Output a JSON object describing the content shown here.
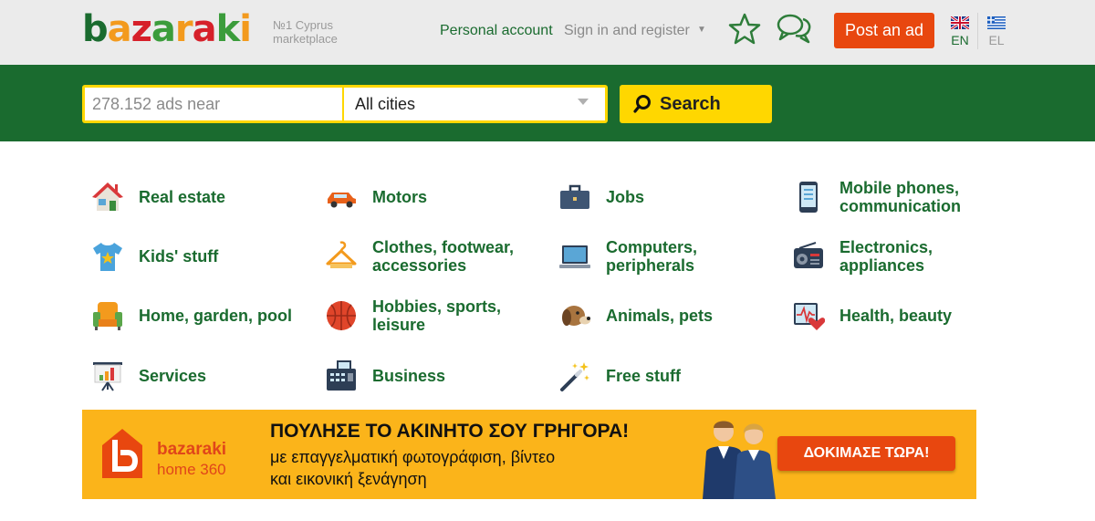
{
  "header": {
    "logo_letters": [
      "b",
      "a",
      "z",
      "a",
      "r",
      "a",
      "k",
      "i"
    ],
    "logo_colors": [
      "#1a6b2f",
      "#f39a1d",
      "#d6202a",
      "#3b9c3b",
      "#f39a1d",
      "#d6202a",
      "#3b9c3b",
      "#f39a1d"
    ],
    "tagline_1": "№1 Cyprus",
    "tagline_2": "marketplace",
    "personal_account": "Personal account",
    "sign_in": "Sign in and register",
    "post_ad": "Post an ad",
    "lang_en": "EN",
    "lang_el": "EL",
    "accent_color": "#e8470f",
    "brand_green": "#1a6b2f"
  },
  "search": {
    "placeholder": "278.152 ads near",
    "city": "All cities",
    "button": "Search",
    "box_color": "#ffd700"
  },
  "categories": {
    "real_estate": "Real estate",
    "motors": "Motors",
    "jobs": "Jobs",
    "mobile": "Mobile phones, communication",
    "kids": "Kids' stuff",
    "clothes": "Clothes, footwear, accessories",
    "computers": "Computers, peripherals",
    "electronics": "Electronics, appliances",
    "home": "Home, garden, pool",
    "hobbies": "Hobbies, sports, leisure",
    "animals": "Animals, pets",
    "health": "Health, beauty",
    "services": "Services",
    "business": "Business",
    "free": "Free stuff"
  },
  "banner": {
    "brand": "bazaraki",
    "sub": "home 360",
    "headline": "ΠΟΥΛΗΣΕ ΤΟ ΑΚΙΝΗΤΟ ΣΟΥ ΓΡΗΓΟΡΑ!",
    "line1": "με επαγγελματική φωτογράφιση, βίντεο",
    "line2": "και εικονική ξενάγηση",
    "cta": "ΔΟΚΙΜΑΣΕ ΤΩΡΑ!",
    "background": "#fbb41a"
  }
}
